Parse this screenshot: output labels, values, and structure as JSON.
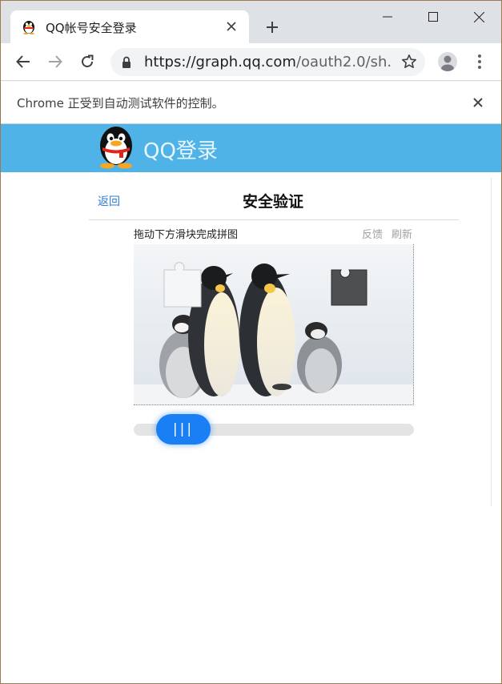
{
  "browser": {
    "tab_title": "QQ帐号安全登录",
    "url_host": "https://graph.qq.com",
    "url_path": "/oauth2.0/sh...",
    "infobar_text": "Chrome 正受到自动测试软件的控制。",
    "icons": {
      "tab_favicon": "qq-penguin-icon",
      "tab_close": "close-icon",
      "new_tab": "plus-icon",
      "minimize": "minimize-icon",
      "maximize": "maximize-icon",
      "close_window": "close-icon",
      "back": "arrow-left-icon",
      "forward": "arrow-right-icon",
      "reload": "reload-icon",
      "lock": "lock-icon",
      "bookmark": "star-icon",
      "profile": "avatar-icon",
      "menu": "kebab-menu-icon"
    }
  },
  "qq": {
    "header_title": "QQ登录",
    "brand_color": "#4fb3e8"
  },
  "verify": {
    "back_label": "返回",
    "title": "安全验证",
    "instruction": "拖动下方滑块完成拼图",
    "feedback_label": "反馈",
    "refresh_label": "刷新",
    "slider_handle_label": "|||",
    "accent_color": "#1a7ff5"
  }
}
